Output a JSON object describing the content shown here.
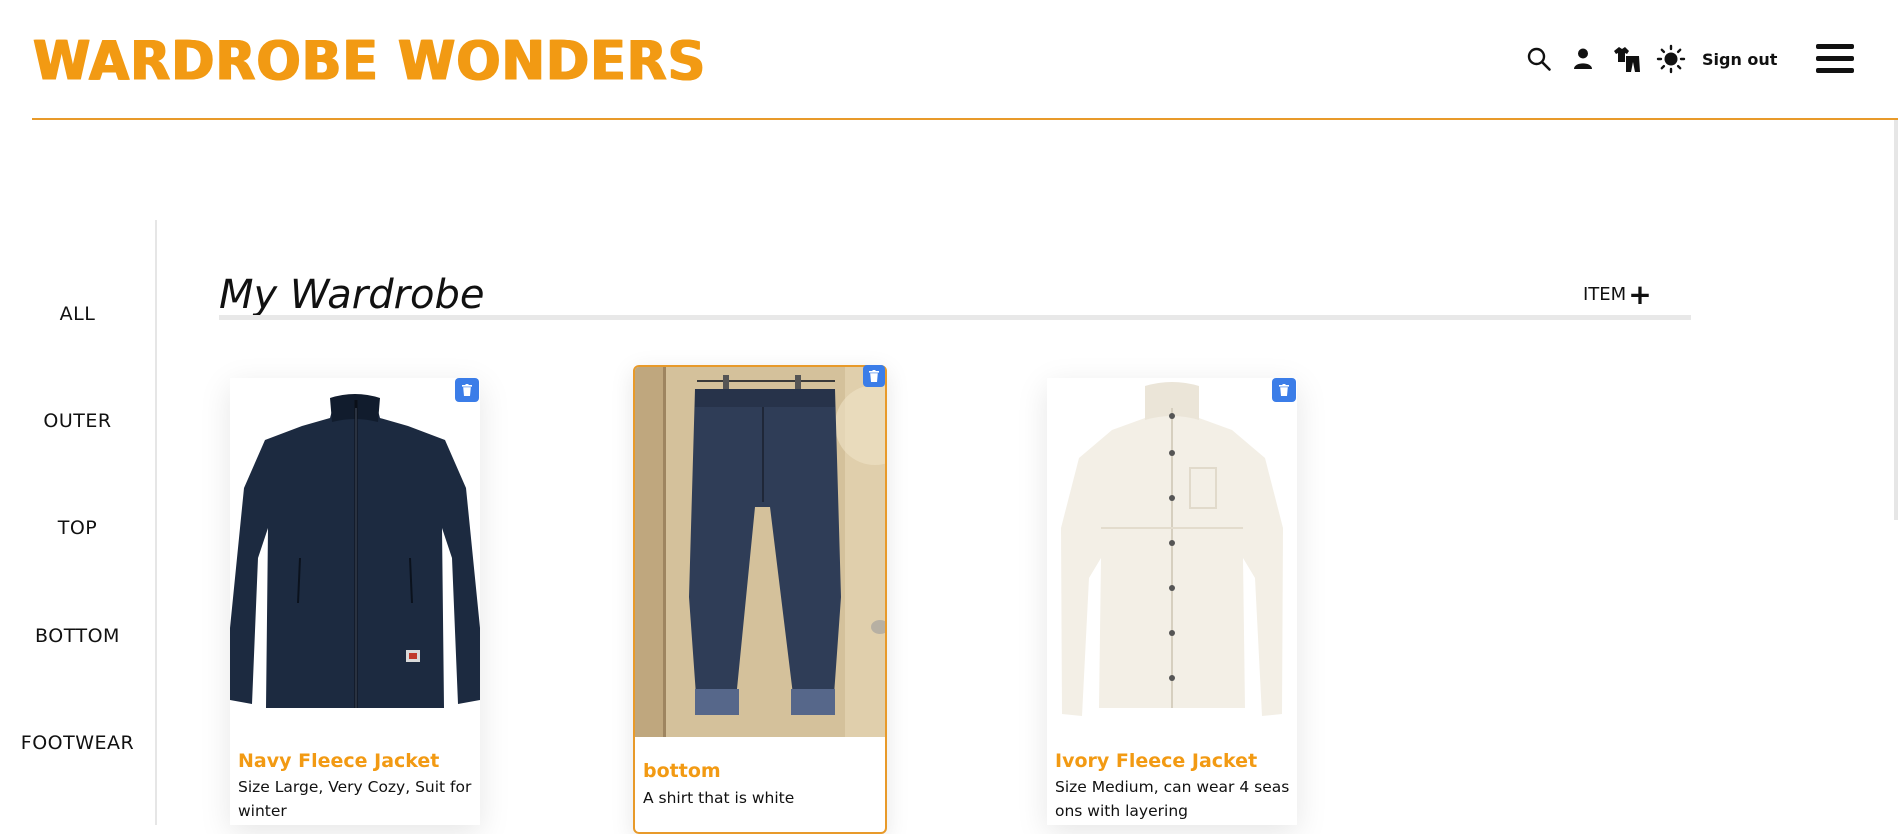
{
  "header": {
    "logo": "WARDROBE WONDERS",
    "icons": [
      "search-icon",
      "user-icon",
      "wardrobe-icon",
      "theme-sun-icon"
    ],
    "signout_label": "Sign out",
    "menu_icon": "hamburger-menu-icon",
    "accent_color": "#f29a13"
  },
  "sidebar": {
    "items": [
      {
        "label": "ALL"
      },
      {
        "label": "OUTER"
      },
      {
        "label": "TOP"
      },
      {
        "label": "BOTTOM"
      },
      {
        "label": "FOOTWEAR"
      }
    ]
  },
  "main": {
    "title": "My Wardrobe",
    "add_label": "ITEM",
    "add_symbol": "+",
    "cards": [
      {
        "name": "Navy Fleece Jacket",
        "description": "Size Large, Very Cozy, Suit for winter",
        "image": "navy-fleece-jacket",
        "delete_icon": "trash-icon"
      },
      {
        "name": "bottom",
        "description": "A shirt that is white",
        "image": "blue-denim-jeans",
        "delete_icon": "trash-icon"
      },
      {
        "name": "Ivory Fleece Jacket",
        "description": "Size Medium, can wear 4 seasons with layering",
        "image": "ivory-fleece-jacket",
        "delete_icon": "trash-icon"
      }
    ],
    "trash_color": "#3b7de8"
  }
}
